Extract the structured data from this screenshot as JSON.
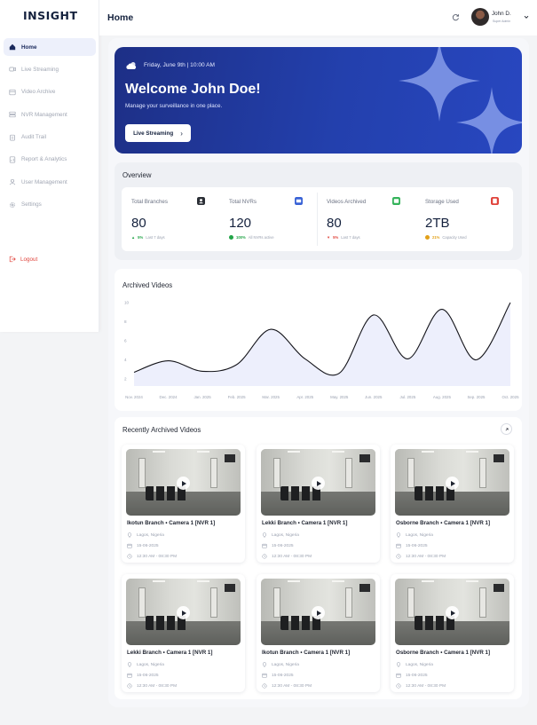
{
  "app": {
    "logo": "INSIGHT",
    "logo_sub": ""
  },
  "sidebar": {
    "items": [
      {
        "label": "Home",
        "icon": "home-icon",
        "active": true
      },
      {
        "label": "Live Streaming",
        "icon": "video-icon"
      },
      {
        "label": "Video Archive",
        "icon": "archive-icon"
      },
      {
        "label": "NVR Management",
        "icon": "server-icon"
      },
      {
        "label": "Audit Trail",
        "icon": "clipboard-icon"
      },
      {
        "label": "Report & Analytics",
        "icon": "report-icon"
      },
      {
        "label": "User Management",
        "icon": "users-icon"
      },
      {
        "label": "Settings",
        "icon": "gear-icon"
      }
    ],
    "logout_label": "Logout"
  },
  "header": {
    "title": "Home",
    "user_name": "John D.",
    "user_role": "Super Admin"
  },
  "banner": {
    "date": "Friday, June 9th | 10:00 AM",
    "welcome": "Welcome John Doe!",
    "subtitle": "Manage your surveillance in one place.",
    "cta_label": "Live Streaming"
  },
  "overview": {
    "title": "Overview",
    "stats": [
      {
        "label": "Total Branches",
        "value": "80",
        "trend_value": "5%",
        "trend_text": "Last 7 days",
        "trend_color": "#22a447",
        "trend_dir": "up",
        "badge_color": "#2b2f36"
      },
      {
        "label": "Total NVRs",
        "value": "120",
        "trend_value": "100%",
        "trend_text": "All NVRs active",
        "trend_color": "#22a447",
        "trend_dir": "check",
        "badge_color": "#3a63d6"
      },
      {
        "label": "Videos Archived",
        "value": "80",
        "trend_value": "5%",
        "trend_text": "Last 7 days",
        "trend_color": "#e0443c",
        "trend_dir": "down",
        "badge_color": "#34b35a"
      },
      {
        "label": "Storage Used",
        "value": "2TB",
        "trend_value": "21%",
        "trend_text": "Capacity Used",
        "trend_color": "#e2a019",
        "trend_dir": "warn",
        "badge_color": "#e0443c"
      }
    ]
  },
  "chart_data": {
    "type": "line",
    "title": "Archived Videos",
    "x": [
      "Nov. 2024",
      "Dec. 2024",
      "Jan. 2025",
      "Feb. 2025",
      "Mar. 2025",
      "Apr. 2025",
      "May. 2025",
      "Jun. 2025",
      "Jul. 2025",
      "Aug. 2025",
      "Sep. 2025",
      "Oct. 2025"
    ],
    "values": [
      2.7,
      3.9,
      2.8,
      3.5,
      7.2,
      4.1,
      2.6,
      8.7,
      4.1,
      9.3,
      4.0,
      10.0
    ],
    "y_ticks": [
      2,
      4,
      6,
      8,
      10
    ],
    "ylim": [
      2,
      10
    ],
    "grid": false,
    "line_color": "#14141a",
    "fill_color": "#e8ebfb"
  },
  "recent": {
    "title": "Recently Archived Videos",
    "videos": [
      {
        "name": "Ikotun Branch • Camera 1 [NVR 1]",
        "location": "Lagos, Nigeria",
        "date": "15-06-2025",
        "time": "12:30 AM - 08:30 PM"
      },
      {
        "name": "Lekki Branch • Camera 1 [NVR 1]",
        "location": "Lagos, Nigeria",
        "date": "15-06-2025",
        "time": "12:30 AM - 08:30 PM"
      },
      {
        "name": "Osborne Branch • Camera 1 [NVR 1]",
        "location": "Lagos, Nigeria",
        "date": "15-06-2025",
        "time": "12:30 AM - 08:30 PM"
      },
      {
        "name": "Lekki Branch • Camera 1 [NVR 1]",
        "location": "Lagos, Nigeria",
        "date": "15-06-2025",
        "time": "12:30 AM - 08:30 PM"
      },
      {
        "name": "Ikotun Branch • Camera 1 [NVR 1]",
        "location": "Lagos, Nigeria",
        "date": "15-06-2025",
        "time": "12:30 AM - 08:30 PM"
      },
      {
        "name": "Osborne Branch • Camera 1 [NVR 1]",
        "location": "Lagos, Nigeria",
        "date": "15-06-2025",
        "time": "12:30 AM - 08:30 PM"
      }
    ]
  }
}
